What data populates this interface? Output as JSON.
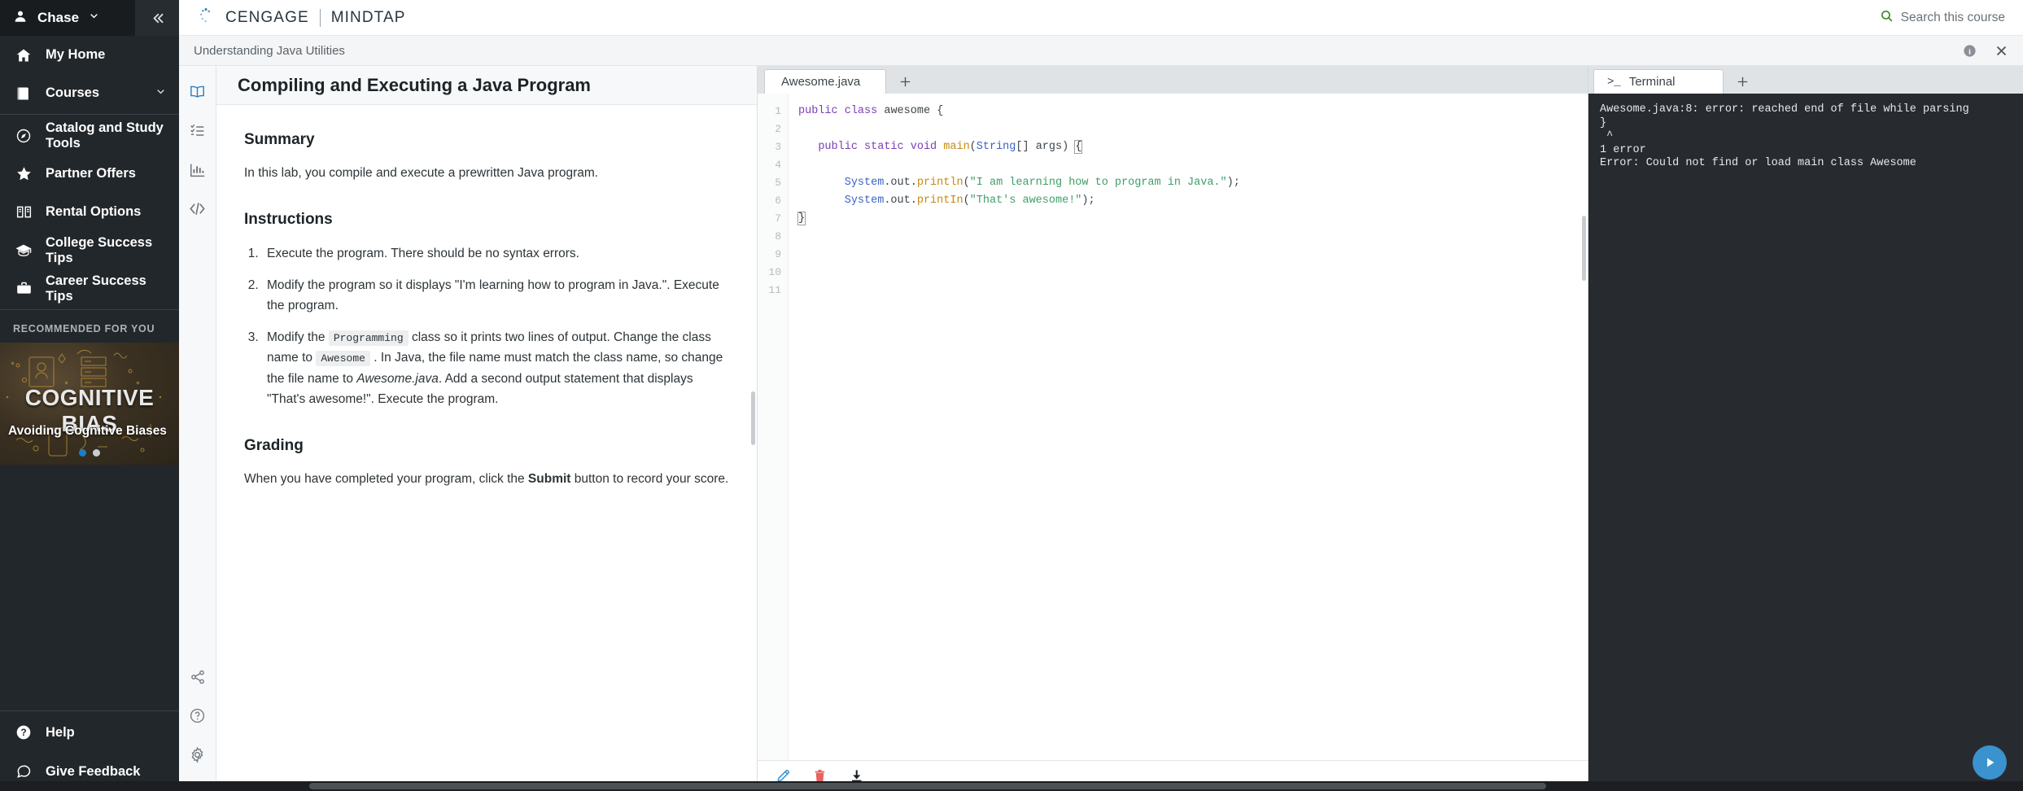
{
  "nav": {
    "user": {
      "name": "Chase",
      "icon": "user-icon",
      "chevron": "chevron-down-icon"
    },
    "collapse_icon": "collapse-left-icon",
    "primary_items": [
      {
        "label": "My Home",
        "icon": "home-icon"
      },
      {
        "label": "Courses",
        "icon": "book-icon",
        "chevron": "chevron-down-icon"
      }
    ],
    "secondary_items": [
      {
        "label": "Catalog and Study Tools",
        "icon": "compass-icon"
      },
      {
        "label": "Partner Offers",
        "icon": "star-icon"
      },
      {
        "label": "Rental Options",
        "icon": "open-book-icon"
      },
      {
        "label": "College Success Tips",
        "icon": "graduation-cap-icon"
      },
      {
        "label": "Career Success Tips",
        "icon": "briefcase-icon"
      }
    ],
    "recommended_label": "RECOMMENDED FOR YOU",
    "promo": {
      "title": "COGNITIVE BIAS",
      "subtitle": "Avoiding Cognitive Biases",
      "dots": 2,
      "active_dot": 0
    },
    "bottom_items": [
      {
        "label": "Help",
        "icon": "help-circle-icon"
      },
      {
        "label": "Give Feedback",
        "icon": "feedback-icon"
      }
    ]
  },
  "topbar": {
    "brand_primary": "CENGAGE",
    "brand_secondary": "MINDTAP",
    "logo_icon": "cengage-burst-icon",
    "search": {
      "label": "Search this course",
      "icon": "search-icon",
      "icon_color": "#3f8a2e"
    }
  },
  "breadcrumb": {
    "text": "Understanding Java Utilities",
    "info_icon": "info-icon",
    "close_icon": "close-icon"
  },
  "rail": {
    "top_items": [
      {
        "icon": "book-open-icon",
        "active": true
      },
      {
        "icon": "checklist-icon",
        "active": false
      },
      {
        "icon": "bar-chart-icon",
        "active": false
      },
      {
        "icon": "code-brackets-icon",
        "active": false
      }
    ],
    "bottom_items": [
      {
        "icon": "share-icon"
      },
      {
        "icon": "question-circle-icon"
      },
      {
        "icon": "gear-icon"
      }
    ]
  },
  "instructions": {
    "title": "Compiling and Executing a Java Program",
    "summary_heading": "Summary",
    "summary_text": "In this lab, you compile and execute a prewritten Java program.",
    "instructions_heading": "Instructions",
    "steps": [
      {
        "parts": [
          {
            "type": "text",
            "value": "Execute the program. There should be no syntax errors."
          }
        ]
      },
      {
        "parts": [
          {
            "type": "text",
            "value": "Modify the program so it displays \"I'm learning how to program in Java.\". Execute the program."
          }
        ]
      },
      {
        "parts": [
          {
            "type": "text",
            "value": "Modify the "
          },
          {
            "type": "code",
            "value": "Programming"
          },
          {
            "type": "text",
            "value": " class so it prints two lines of output. Change the class name to "
          },
          {
            "type": "code",
            "value": "Awesome"
          },
          {
            "type": "text",
            "value": " . In Java, the file name must match the class name, so change the file name to "
          },
          {
            "type": "italic",
            "value": "Awesome.java"
          },
          {
            "type": "text",
            "value": ". Add a second output statement that displays \"That's awesome!\". Execute the program."
          }
        ]
      }
    ],
    "grading_heading": "Grading",
    "grading_parts": [
      {
        "type": "text",
        "value": "When you have completed your program, click the "
      },
      {
        "type": "bold",
        "value": "Submit"
      },
      {
        "type": "text",
        "value": " button to record your score."
      }
    ]
  },
  "editor": {
    "tabs": [
      {
        "label": "Awesome.java",
        "active": true
      }
    ],
    "add_tab_icon": "plus-icon",
    "line_numbers": [
      "1",
      "2",
      "3",
      "4",
      "5",
      "6",
      "7",
      "8",
      "9",
      "10",
      "11"
    ],
    "code_lines": [
      "",
      "public class awesome {",
      "",
      "   public static void main(String[] args) {",
      "",
      "       System.out.println(\"I am learning how to program in Java.\");",
      "       System.out.printIn(\"That's awesome!\");",
      "}",
      "",
      "",
      ""
    ],
    "toolbar": [
      {
        "icon": "pencil-icon",
        "color": "#3a92cf"
      },
      {
        "icon": "trash-icon",
        "color": "#e8615c"
      },
      {
        "icon": "download-icon",
        "color": "#1f2326"
      }
    ]
  },
  "terminal": {
    "tab_label": "Terminal",
    "tab_prompt": ">_",
    "add_tab_icon": "plus-icon",
    "output": "Awesome.java:8: error: reached end of file while parsing\n}\n ^\n1 error\nError: Could not find or load main class Awesome"
  },
  "run_button": {
    "icon": "play-icon",
    "color": "#3a92cf"
  }
}
